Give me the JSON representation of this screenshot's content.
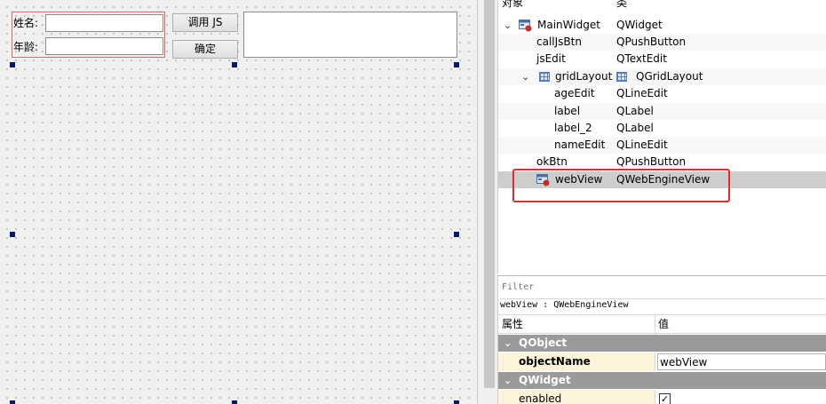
{
  "form": {
    "name_label": "姓名:",
    "age_label": "年龄:",
    "call_js_button": "调用 JS",
    "ok_button": "确定"
  },
  "object_inspector": {
    "col_object": "对象",
    "col_class": "类",
    "items": [
      {
        "name": "MainWidget",
        "class": "QWidget"
      },
      {
        "name": "callJsBtn",
        "class": "QPushButton"
      },
      {
        "name": "jsEdit",
        "class": "QTextEdit"
      },
      {
        "name": "gridLayout",
        "class": "QGridLayout"
      },
      {
        "name": "ageEdit",
        "class": "QLineEdit"
      },
      {
        "name": "label",
        "class": "QLabel"
      },
      {
        "name": "label_2",
        "class": "QLabel"
      },
      {
        "name": "nameEdit",
        "class": "QLineEdit"
      },
      {
        "name": "okBtn",
        "class": "QPushButton"
      },
      {
        "name": "webView",
        "class": "QWebEngineView"
      }
    ],
    "selected": "webView"
  },
  "property_editor": {
    "filter_placeholder": "Filter",
    "object_path": "webView : QWebEngineView",
    "col_property": "属性",
    "col_value": "值",
    "groups": [
      {
        "name": "QObject"
      },
      {
        "name": "QWidget"
      }
    ],
    "object_name_label": "objectName",
    "object_name_value": "webView",
    "enabled_label": "enabled",
    "enabled_checked": true
  },
  "colors": {
    "highlight": "#e8282e",
    "group_bg": "#9a9a9a",
    "selected_row": "#cdcdcd",
    "layout_frame": "#e06666"
  }
}
